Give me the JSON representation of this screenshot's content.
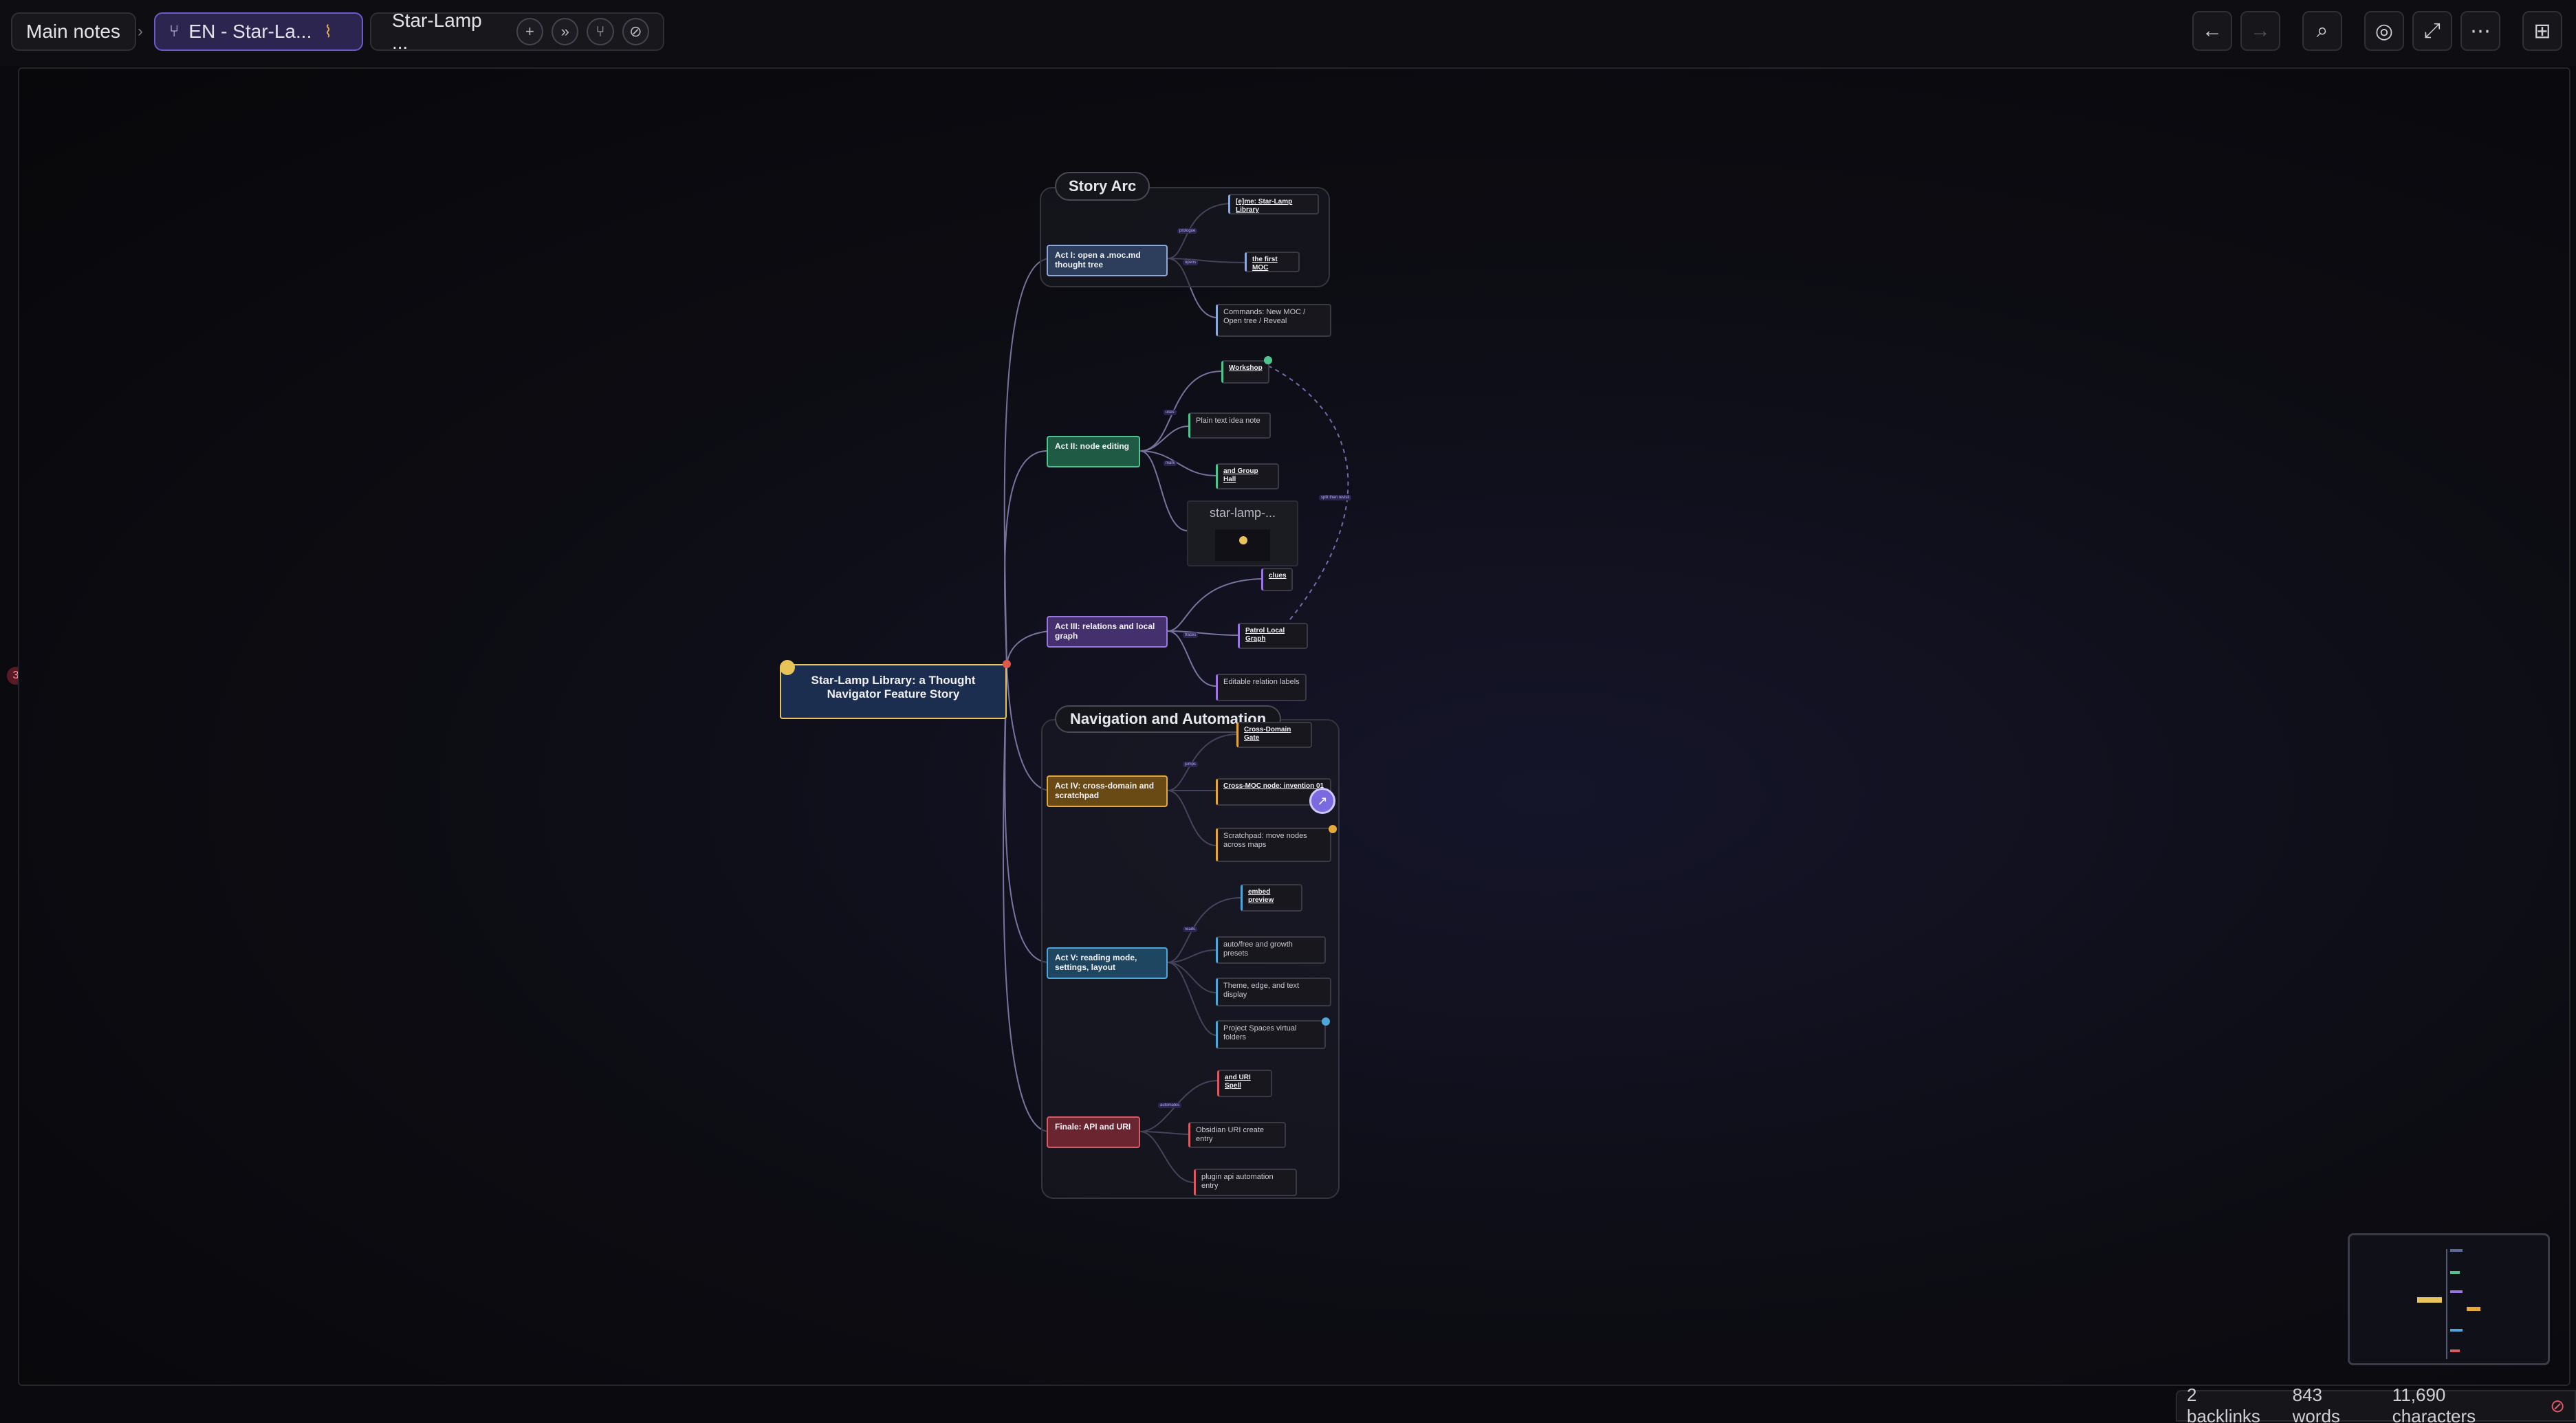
{
  "tabs": {
    "main_notes": "Main notes",
    "active_tab": "EN - Star-La...",
    "second_tab": "Star-Lamp ..."
  },
  "groups": {
    "story_arc": "Story Arc",
    "navigation": "Navigation and Automation"
  },
  "root": "Star-Lamp Library: a Thought Navigator Feature Story",
  "acts": {
    "act1": "Act I: open a .moc.md thought tree",
    "act2": "Act II: node editing",
    "act3": "Act III: relations and local graph",
    "act4": "Act IV: cross-domain and scratchpad",
    "act5": "Act V: reading mode, settings, layout",
    "finale": "Finale: API and URI"
  },
  "leaves": {
    "star_lamp_library": "[e]me: Star-Lamp Library",
    "first_moc": "the first MOC",
    "commands": "Commands: New MOC / Open tree / Reveal",
    "workshop": "Workshop",
    "plain_text": "Plain text idea note",
    "group_hall": "and Group Hall",
    "image_title": "star-lamp-...",
    "clues": "clues",
    "patrol": "Patrol Local Graph",
    "editable": "Editable relation labels",
    "cross_domain_gate": "Cross-Domain Gate",
    "cross_moc": "Cross-MOC node: invention 01",
    "scratchpad": "Scratchpad: move nodes across maps",
    "embed_preview": "embed preview",
    "auto_free": "auto/free and growth presets",
    "theme": "Theme, edge, and text display",
    "project_spaces": "Project Spaces virtual folders",
    "uri_spell": "and URI Spell",
    "obsidian_uri": "Obsidian URI create entry",
    "plugin_api": "plugin api automation entry"
  },
  "edge_labels": {
    "e1": "prologue",
    "e2": "opens",
    "e3": "uses",
    "e4": "mark",
    "e5": "split then revisit",
    "e6": "traces",
    "e7": "jumps",
    "e8": "reads",
    "e9": "automates"
  },
  "status": {
    "backlinks": "2 backlinks",
    "words": "843 words",
    "characters": "11,690 characters"
  },
  "side_badge": "3",
  "colors": {
    "accent": "#6a5ccc",
    "act1": "#2c3e5c",
    "act2": "#1f5a45",
    "act3": "#45306e",
    "act4": "#6a4a14",
    "act5": "#1f4660",
    "finale": "#6a2530",
    "root": "#1c2e50"
  }
}
